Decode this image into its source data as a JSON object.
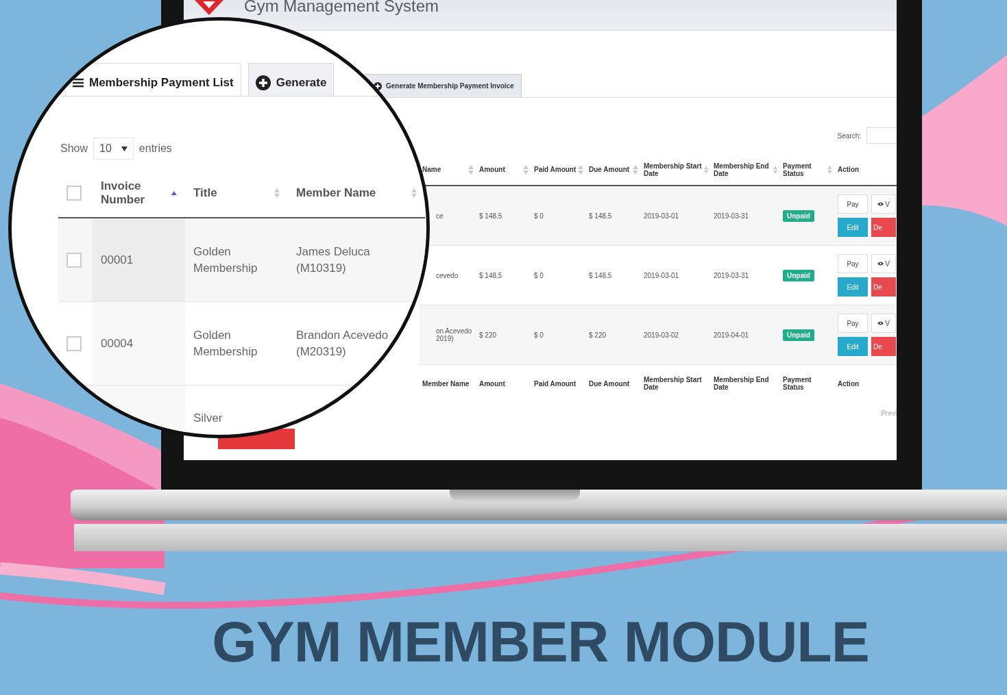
{
  "app": {
    "title": "Gym Management System"
  },
  "screen": {
    "tabs": [
      {
        "label": "Generate Membership Payment Invoice",
        "selected": false
      }
    ],
    "search": {
      "label": "Search:"
    },
    "table": {
      "columns": [
        {
          "label": "Name",
          "sortable": true
        },
        {
          "label": "Amount",
          "sortable": true
        },
        {
          "label": "Paid Amount",
          "sortable": true
        },
        {
          "label": "Due Amount",
          "sortable": true
        },
        {
          "label": "Membership Start Date",
          "sortable": true
        },
        {
          "label": "Membership End Date",
          "sortable": true
        },
        {
          "label": "Payment Status",
          "sortable": true
        },
        {
          "label": "Action",
          "sortable": false
        }
      ],
      "rows": [
        {
          "member": [
            "ce"
          ],
          "amount": "$ 148.5",
          "paid": "$ 0",
          "due": "$ 148.5",
          "start": "2019-03-01",
          "end": "2019-03-31",
          "status": "Unpaid",
          "actions": [
            "Pay",
            "V",
            "Edit",
            "De"
          ]
        },
        {
          "member": [
            "cevedo"
          ],
          "amount": "$ 148.5",
          "paid": "$ 0",
          "due": "$ 148.5",
          "start": "2019-03-01",
          "end": "2019-03-31",
          "status": "Unpaid",
          "actions": [
            "Pay",
            "V",
            "Edit",
            "De"
          ]
        },
        {
          "member": [
            "on Acevedo",
            "2019)"
          ],
          "amount": "$ 220",
          "paid": "$ 0",
          "due": "$ 220",
          "start": "2019-03-02",
          "end": "2019-04-01",
          "status": "Unpaid",
          "actions": [
            "Pay",
            "V",
            "Edit",
            "De"
          ]
        }
      ],
      "footer": [
        "Member Name",
        "Amount",
        "Paid Amount",
        "Due Amount",
        "Membership Start Date",
        "Membership End Date",
        "Payment Status",
        "Action"
      ]
    },
    "pagination": "Previ"
  },
  "magnifier": {
    "tabs": [
      {
        "label": "Membership Payment List",
        "selected": true
      },
      {
        "label": "Generate",
        "selected": false
      }
    ],
    "length": {
      "prefix": "Show",
      "value": "10",
      "suffix": "entries"
    },
    "select_all": {
      "checked": false
    },
    "columns": [
      {
        "label": "Invoice Number",
        "sorted": true
      },
      {
        "label": "Title",
        "sorted": false
      },
      {
        "label": "Member Name",
        "sorted": false
      }
    ],
    "rows": [
      {
        "checked": false,
        "invoice": "00001",
        "title": "Golden Membership",
        "member": "James Deluca (M10319)"
      },
      {
        "checked": false,
        "invoice": "00004",
        "title": "Golden Membership",
        "member": "Brandon Acevedo (M20319)"
      },
      {
        "title": "Silver"
      }
    ]
  },
  "caption": "GYM MEMBER MODULE"
}
